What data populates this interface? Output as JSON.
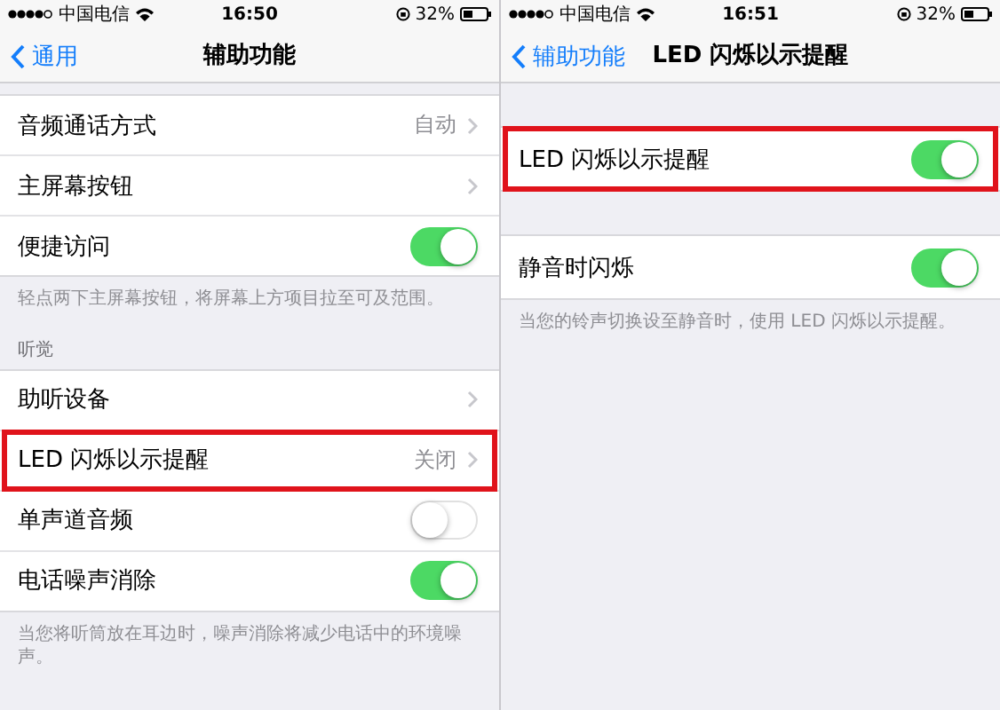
{
  "panels": [
    {
      "status_bar": {
        "carrier": "中国电信",
        "time": "16:50",
        "battery": "32%"
      },
      "nav": {
        "back": "通用",
        "title": "辅助功能"
      },
      "sections": [
        {
          "rows": [
            {
              "label": "音频通话方式",
              "kind": "disclosure",
              "value": "自动",
              "highlighted": false
            },
            {
              "label": "主屏幕按钮",
              "kind": "disclosure",
              "highlighted": false
            },
            {
              "label": "便捷访问",
              "kind": "toggle",
              "on": true,
              "highlighted": false
            }
          ],
          "footer": "轻点两下主屏幕按钮，将屏幕上方项目拉至可及范围。"
        },
        {
          "header": "听觉",
          "rows": [
            {
              "label": "助听设备",
              "kind": "disclosure",
              "highlighted": false
            },
            {
              "label": "LED 闪烁以示提醒",
              "kind": "disclosure",
              "value": "关闭",
              "highlighted": true
            },
            {
              "label": "单声道音频",
              "kind": "toggle",
              "on": false,
              "highlighted": false
            },
            {
              "label": "电话噪声消除",
              "kind": "toggle",
              "on": true,
              "highlighted": false
            }
          ],
          "footer": "当您将听筒放在耳边时，噪声消除将减少电话中的环境噪声。"
        }
      ]
    },
    {
      "status_bar": {
        "carrier": "中国电信",
        "time": "16:51",
        "battery": "32%"
      },
      "nav": {
        "back": "辅助功能",
        "title": "LED 闪烁以示提醒"
      },
      "sections": [
        {
          "rows": [
            {
              "label": "LED 闪烁以示提醒",
              "kind": "toggle",
              "on": true,
              "highlighted": true
            }
          ]
        },
        {
          "rows": [
            {
              "label": "静音时闪烁",
              "kind": "toggle",
              "on": true,
              "highlighted": false
            }
          ],
          "footer": "当您的铃声切换设至静音时，使用 LED 闪烁以示提醒。"
        }
      ]
    }
  ]
}
